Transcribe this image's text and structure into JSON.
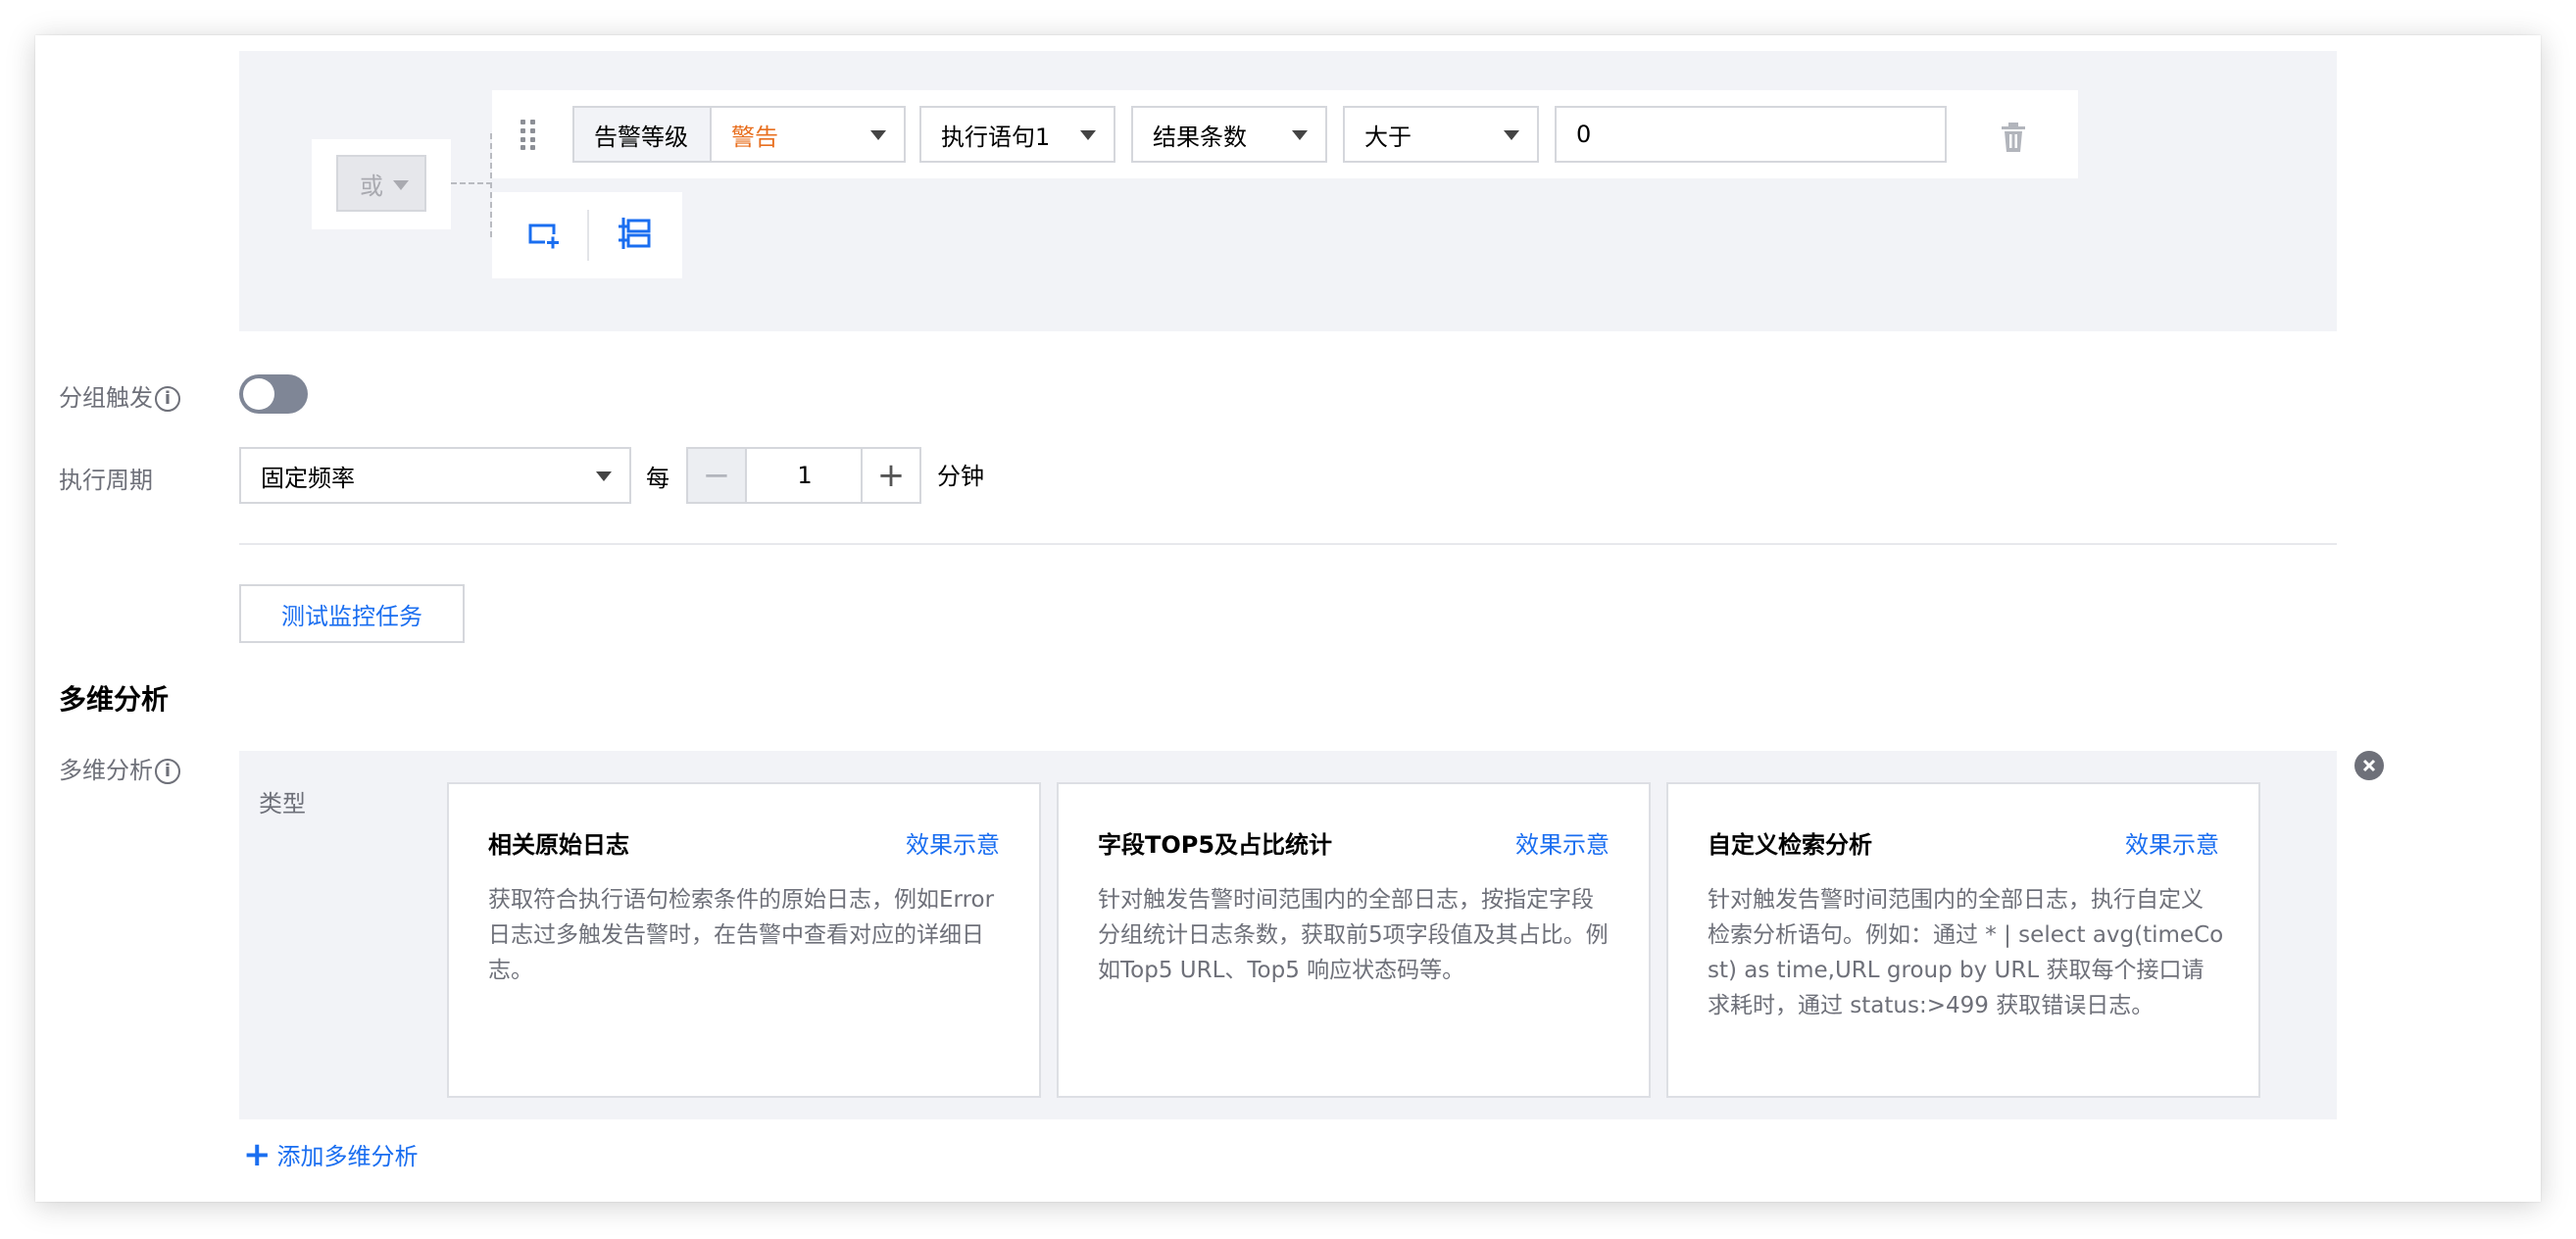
{
  "condition": {
    "logic_operator": "或",
    "rule": {
      "level_label": "告警等级",
      "level_value": "警告",
      "statement": "执行语句1",
      "metric": "结果条数",
      "comparator": "大于",
      "threshold": "0"
    },
    "icons": {
      "drag": "drag-handle-icon",
      "delete": "trash-icon",
      "add_condition": "add-condition-icon",
      "add_group": "add-group-icon"
    }
  },
  "group_trigger": {
    "label": "分组触发",
    "enabled": false
  },
  "exec_cycle": {
    "label": "执行周期",
    "mode": "固定频率",
    "every_text": "每",
    "value": "1",
    "unit": "分钟"
  },
  "test_button": "测试监控任务",
  "multi_analysis": {
    "section_title": "多维分析",
    "label": "多维分析",
    "type_label": "类型",
    "cards": [
      {
        "title": "相关原始日志",
        "link": "效果示意",
        "desc": "获取符合执行语句检索条件的原始日志，例如Error日志过多触发告警时，在告警中查看对应的详细日志。"
      },
      {
        "title": "字段TOP5及占比统计",
        "link": "效果示意",
        "desc": "针对触发告警时间范围内的全部日志，按指定字段分组统计日志条数，获取前5项字段值及其占比。例如Top5 URL、Top5 响应状态码等。"
      },
      {
        "title": "自定义检索分析",
        "link": "效果示意",
        "desc": "针对触发告警时间范围内的全部日志，执行自定义检索分析语句。例如：通过 * | select avg(timeCost) as time,URL group by URL 获取每个接口请求耗时，通过 status:>499 获取错误日志。"
      }
    ],
    "add_label": "添加多维分析"
  },
  "colors": {
    "primary": "#1a6ef0",
    "warning": "#e86f1f",
    "panel_bg": "#f2f3f7"
  }
}
